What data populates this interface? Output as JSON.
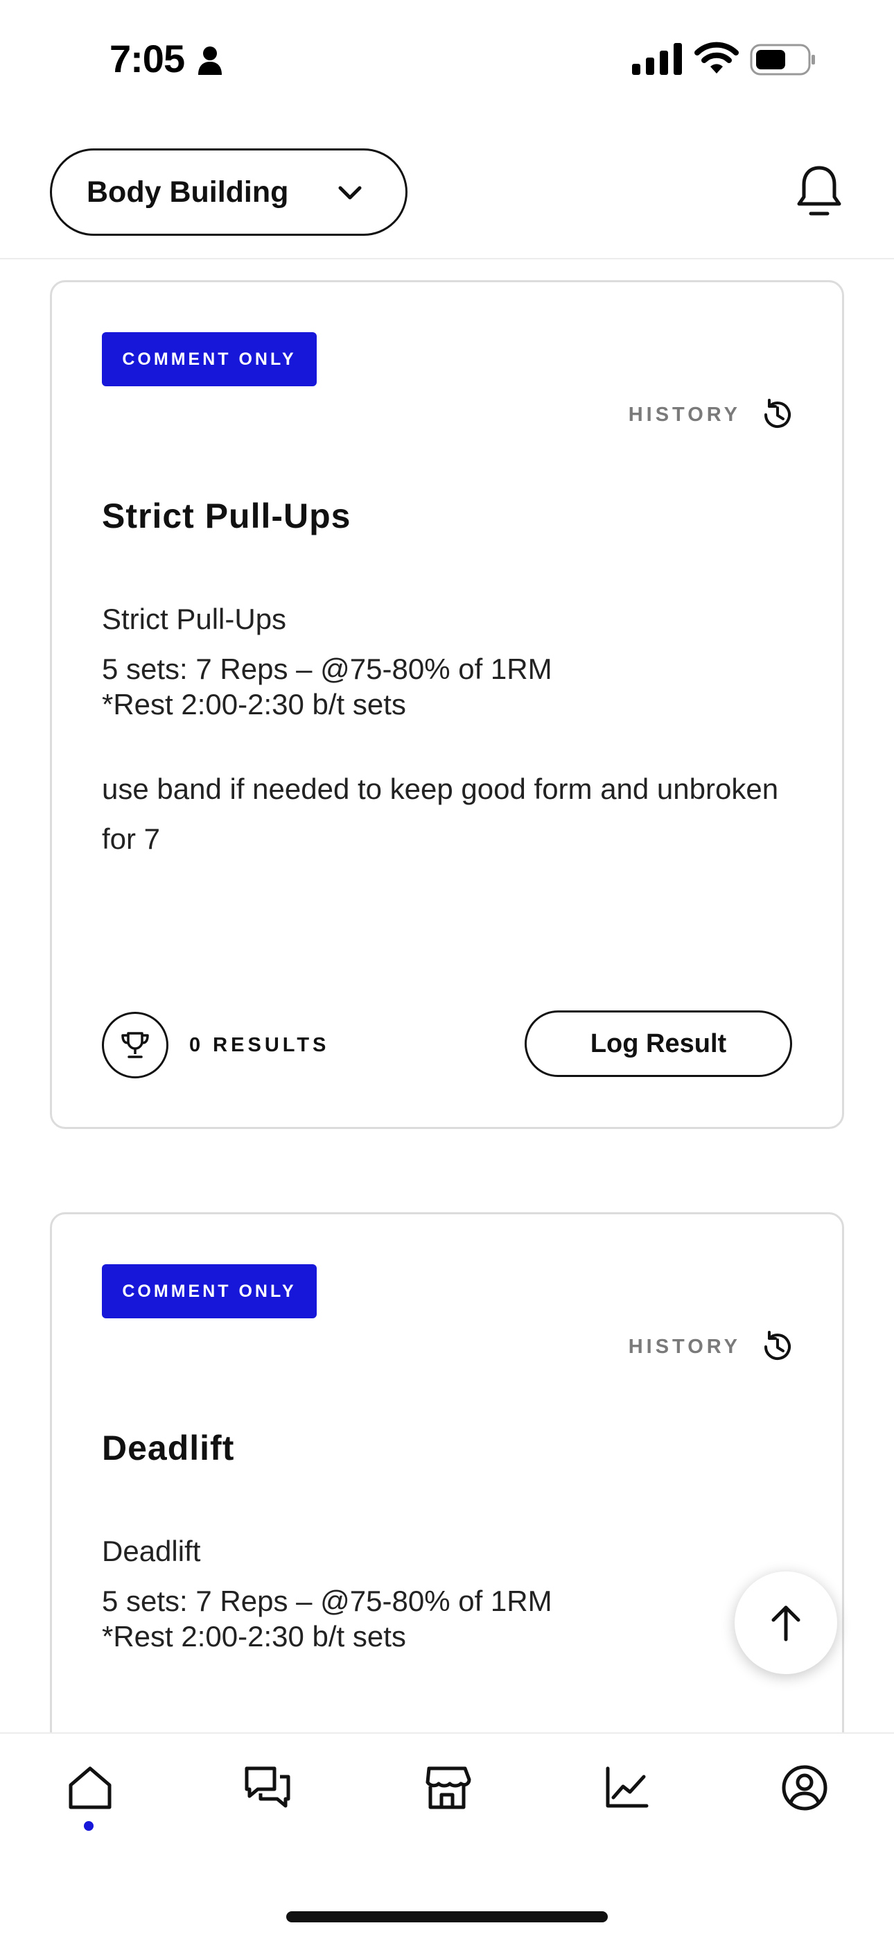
{
  "status_bar": {
    "time": "7:05"
  },
  "header": {
    "program": "Body Building",
    "icons": [
      "chevron-down-icon",
      "bell-icon"
    ]
  },
  "workouts": [
    {
      "badge": "COMMENT ONLY",
      "history_label": "HISTORY",
      "title": "Strict Pull-Ups",
      "description": [
        "Strict Pull-Ups\n5 sets: 7 Reps – @75-80% of 1RM",
        "*Rest 2:00-2:30 b/t sets",
        "use band if needed to keep good form and unbroken for 7"
      ],
      "results_label": "0 RESULTS",
      "log_button": "Log Result"
    },
    {
      "badge": "COMMENT ONLY",
      "history_label": "HISTORY",
      "title": "Deadlift",
      "description": [
        "Deadlift\n5 sets: 7 Reps – @75-80% of 1RM",
        "*Rest 2:00-2:30 b/t sets"
      ]
    }
  ],
  "fab": {
    "icon": "arrow-up-icon"
  },
  "bottom_nav": {
    "items": [
      "home-icon",
      "chat-icon",
      "store-icon",
      "chart-icon",
      "profile-icon"
    ],
    "active": "home-icon",
    "accent_color": "#1717d9"
  }
}
